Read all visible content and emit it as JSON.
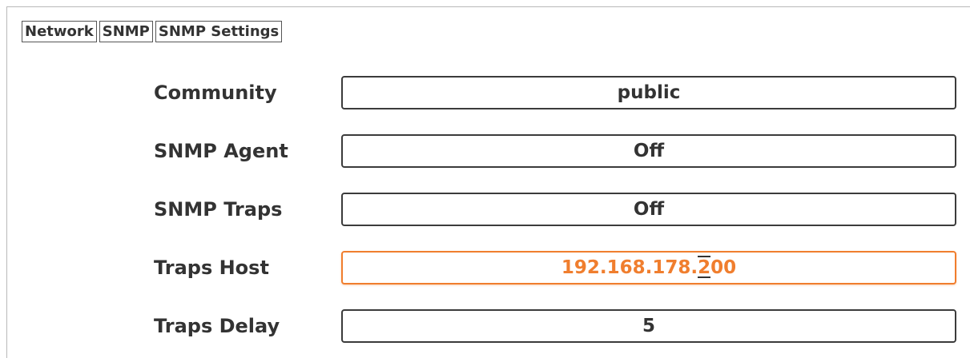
{
  "breadcrumb": [
    "Network",
    "SNMP",
    "SNMP Settings"
  ],
  "settings": [
    {
      "label": "Community",
      "value": "public"
    },
    {
      "label": "SNMP Agent",
      "value": "Off"
    },
    {
      "label": "SNMP Traps",
      "value": "Off"
    },
    {
      "label": "Traps Host",
      "value_before_cursor": "192.168.178.",
      "cursor_char": "2",
      "value_after_cursor": "00"
    },
    {
      "label": "Traps Delay",
      "value": "5"
    }
  ],
  "colors": {
    "active_field": "#f07e2e",
    "border": "#3b3b3b",
    "text": "#333333"
  }
}
